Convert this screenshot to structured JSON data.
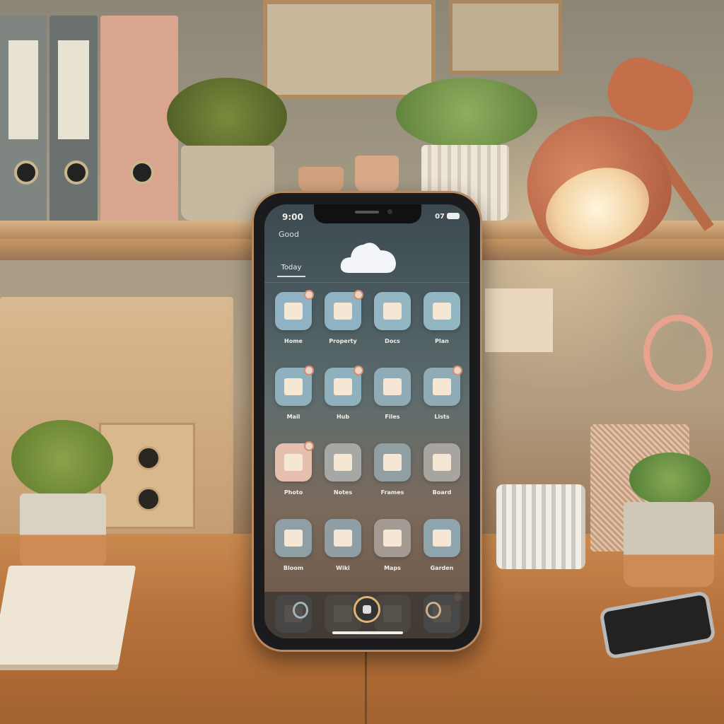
{
  "status_bar": {
    "time": "9:00",
    "battery_text": "07",
    "signal": "full"
  },
  "header": {
    "greeting": "Good",
    "weather_icon": "cloud-icon",
    "tab_label": "Today"
  },
  "apps": [
    {
      "label": "Home",
      "icon": "house-check",
      "color": "#8fb3c2",
      "badge": true
    },
    {
      "label": "Property",
      "icon": "house",
      "color": "#8fb3c2",
      "badge": true
    },
    {
      "label": "Docs",
      "icon": "document",
      "color": "#93b6c3",
      "badge": false
    },
    {
      "label": "Plan",
      "icon": "list",
      "color": "#93b6c3",
      "badge": false
    },
    {
      "label": "Mail",
      "icon": "envelope",
      "color": "#8fb0bd",
      "badge": true
    },
    {
      "label": "Hub",
      "icon": "house",
      "color": "#8fb0bd",
      "badge": true
    },
    {
      "label": "Files",
      "icon": "ledger",
      "color": "#8facb6",
      "badge": false
    },
    {
      "label": "Lists",
      "icon": "table",
      "color": "#8facb6",
      "badge": true
    },
    {
      "label": "Photo",
      "icon": "camera",
      "color": "#e6bfae",
      "badge": true
    },
    {
      "label": "Notes",
      "icon": "note",
      "color": "#a6a8a6",
      "badge": false
    },
    {
      "label": "Frames",
      "icon": "frame",
      "color": "#909fa2",
      "badge": false
    },
    {
      "label": "Board",
      "icon": "notepad",
      "color": "#a8a4a0",
      "badge": false
    },
    {
      "label": "Bloom",
      "icon": "flower",
      "color": "#8f9fa6",
      "badge": false
    },
    {
      "label": "Wiki",
      "icon": "book",
      "color": "#8f9ea4",
      "badge": false
    },
    {
      "label": "Maps",
      "icon": "map",
      "color": "#a39a94",
      "badge": false
    },
    {
      "label": "Garden",
      "icon": "leaf",
      "color": "#8fa5ae",
      "badge": false
    },
    {
      "label": "",
      "icon": "bag",
      "color": "#8d9da3",
      "badge": false
    },
    {
      "label": "",
      "icon": "frame",
      "color": "#a69a90",
      "badge": false
    },
    {
      "label": "",
      "icon": "shelf",
      "color": "#a69a90",
      "badge": false
    },
    {
      "label": "",
      "icon": "chef",
      "color": "#8aa9b8",
      "badge": true
    }
  ],
  "dock": {
    "left_icon": "location-icon",
    "center_icon": "home-button-icon",
    "right_icon": "compass-icon"
  }
}
